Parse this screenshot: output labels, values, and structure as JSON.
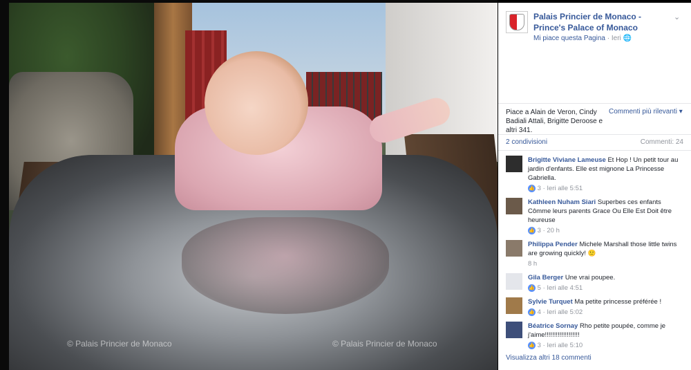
{
  "photo": {
    "watermarks": [
      "© Palais Princier de Monaco",
      "© Palais Princier de Monaco"
    ]
  },
  "header": {
    "page_name": "Palais Princier de Monaco - Prince's Palace of Monaco",
    "like_page": "Mi piace questa Pagina",
    "separator": "·",
    "time": "Ieri",
    "globe": "🌐",
    "menu": "⌄"
  },
  "likes": {
    "text": "Piace a Alain de Veron, Cindy Badiali Attali, Brigitte Deroose e altri 341.",
    "relevant": "Commenti più rilevanti ▾"
  },
  "shares": {
    "shares": "2 condivisioni",
    "comments": "Commenti: 24"
  },
  "comments": [
    {
      "author": "Brigitte Viviane Lameuse",
      "text": "Et Hop ! Un petit tour au jardin d'enfants. Elle est mignone La Princesse Gabriella.",
      "likes": "3",
      "time": "· Ieri alle 5:51"
    },
    {
      "author": "Kathleen Nuham Siari",
      "text": "Superbes ces enfants Cômme leurs parents Grace Ou Elle Est Doit être heureuse",
      "likes": "3",
      "time": "· 20 h"
    },
    {
      "author": "Philippa Pender",
      "text": "Michele Marshall those little twins are growing quickly! 🙂",
      "likes": "",
      "time": "8 h"
    },
    {
      "author": "Gila Berger",
      "text": "Une vrai poupee.",
      "likes": "5",
      "time": "· Ieri alle 4:51"
    },
    {
      "author": "Sylvie Turquet",
      "text": "Ma petite princesse préférée !",
      "likes": "4",
      "time": "· Ieri alle 5:02"
    },
    {
      "author": "Béatrice Sornay",
      "text": "Rho petite poupée, comme je j'aime!!!!!!!!!!!!!!!!!!!",
      "likes": "3",
      "time": "· Ieri alle 5:10"
    }
  ],
  "more_comments": "Visualizza altri 18 commenti",
  "colors": {
    "link": "#365899",
    "muted": "#90949c",
    "like_blue": "#5890ff"
  }
}
